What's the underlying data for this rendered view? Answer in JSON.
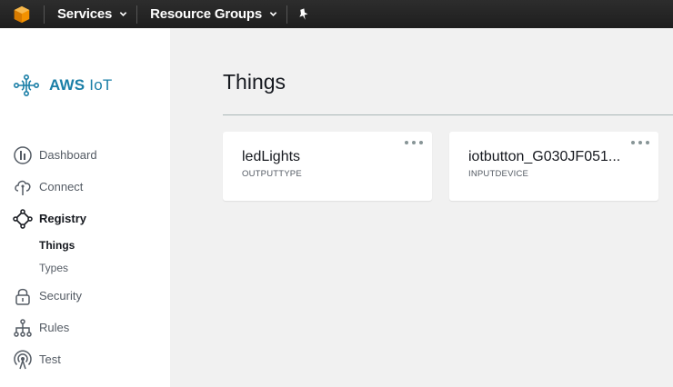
{
  "topbar": {
    "services_label": "Services",
    "resource_groups_label": "Resource Groups"
  },
  "sidebar": {
    "brand_bold": "AWS",
    "brand_rest": "IoT",
    "items": [
      {
        "label": "Dashboard",
        "icon": "dashboard-icon"
      },
      {
        "label": "Connect",
        "icon": "cloud-icon"
      },
      {
        "label": "Registry",
        "icon": "registry-icon"
      },
      {
        "label": "Things",
        "icon": null
      },
      {
        "label": "Types",
        "icon": null
      },
      {
        "label": "Security",
        "icon": "lock-icon"
      },
      {
        "label": "Rules",
        "icon": "rules-icon"
      },
      {
        "label": "Test",
        "icon": "broadcast-icon"
      }
    ]
  },
  "main": {
    "title": "Things",
    "cards": [
      {
        "name": "ledLights",
        "type": "OUTPUTTYPE"
      },
      {
        "name": "iotbutton_G030JF051...",
        "type": "INPUTDEVICE"
      }
    ]
  },
  "colors": {
    "topbar": "#232f3e",
    "brand": "#1b7fa7",
    "aws_orange": "#f29100",
    "background": "#f1f1f1"
  }
}
